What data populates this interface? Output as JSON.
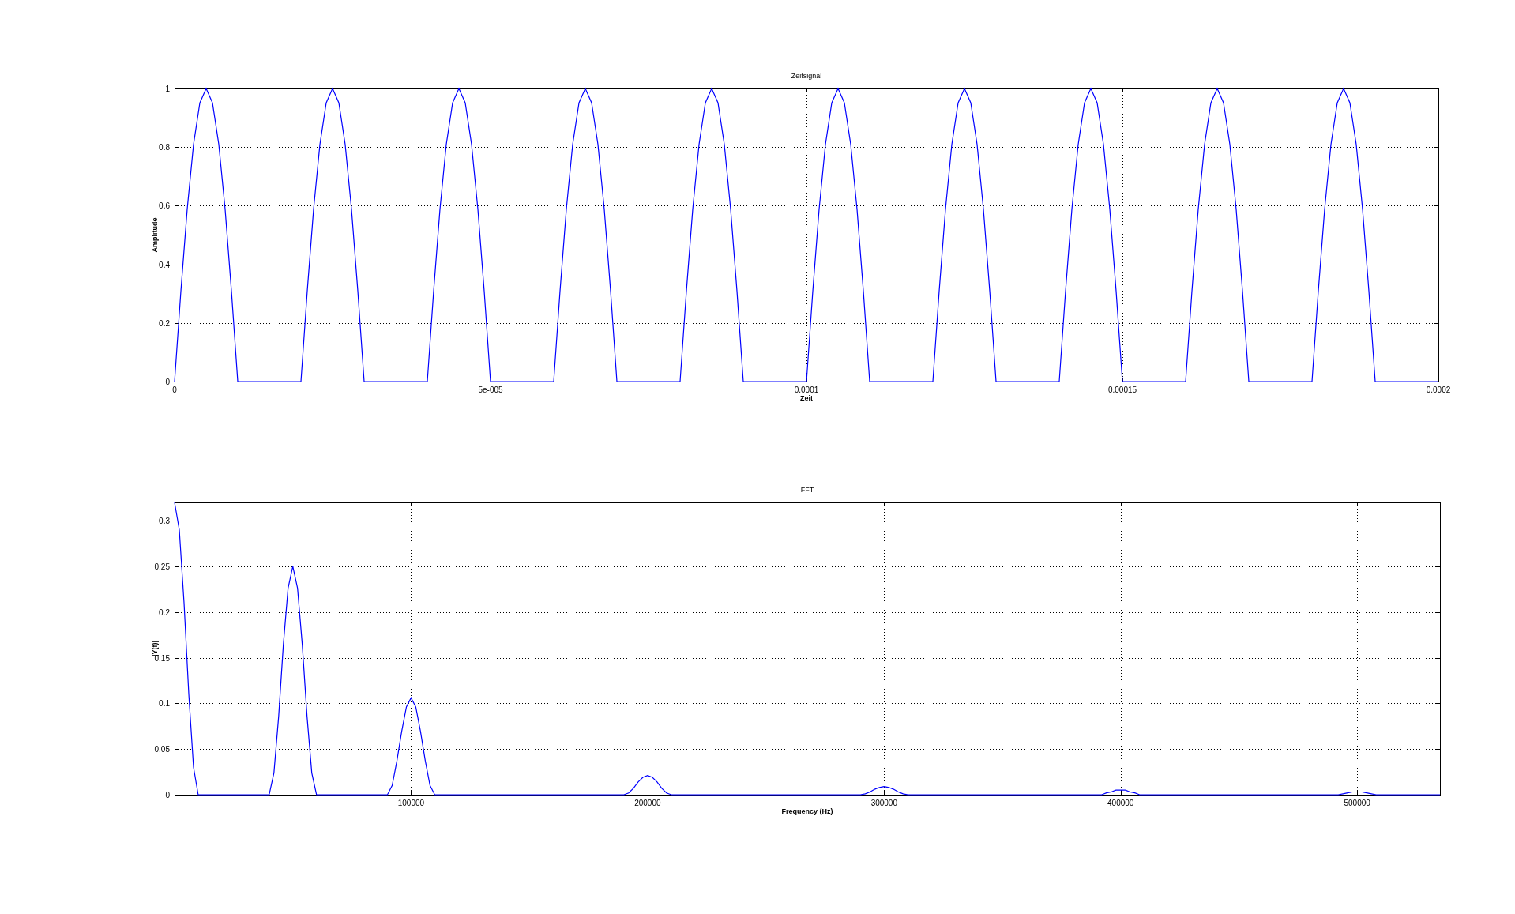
{
  "plots": [
    {
      "chart_data": {
        "type": "line",
        "title": "Zeitsignal",
        "xlabel": "Zeit",
        "ylabel": "Amplitude",
        "x": [
          0,
          1e-06,
          2e-06,
          3e-06,
          4e-06,
          5e-06,
          6e-06,
          7e-06,
          8e-06,
          9e-06,
          1e-05,
          2e-05,
          2.1e-05,
          2.2e-05,
          2.3e-05,
          2.4e-05,
          2.5e-05,
          2.6e-05,
          2.7e-05,
          2.8e-05,
          2.9e-05,
          3e-05,
          4e-05,
          4.1e-05,
          4.2e-05,
          4.3e-05,
          4.4e-05,
          4.5e-05,
          4.6e-05,
          4.7e-05,
          4.8e-05,
          4.9e-05,
          5e-05,
          6e-05,
          6.1e-05,
          6.2e-05,
          6.3e-05,
          6.4e-05,
          6.5e-05,
          6.6e-05,
          6.7e-05,
          6.8e-05,
          6.9e-05,
          7e-05,
          8e-05,
          8.1e-05,
          8.2e-05,
          8.3e-05,
          8.4e-05,
          8.5e-05,
          8.6e-05,
          8.7e-05,
          8.8e-05,
          8.9e-05,
          9e-05,
          0.0001,
          0.000101,
          0.000102,
          0.000103,
          0.000104,
          0.000105,
          0.000106,
          0.000107,
          0.000108,
          0.000109,
          0.00011,
          0.00012,
          0.000121,
          0.000122,
          0.000123,
          0.000124,
          0.000125,
          0.000126,
          0.000127,
          0.000128,
          0.000129,
          0.00013,
          0.00014,
          0.000141,
          0.000142,
          0.000143,
          0.000144,
          0.000145,
          0.000146,
          0.000147,
          0.000148,
          0.000149,
          0.00015,
          0.00016,
          0.000161,
          0.000162,
          0.000163,
          0.000164,
          0.000165,
          0.000166,
          0.000167,
          0.000168,
          0.000169,
          0.00017,
          0.00018,
          0.000181,
          0.000182,
          0.000183,
          0.000184,
          0.000185,
          0.000186,
          0.000187,
          0.000188,
          0.000189,
          0.00019,
          0.0002
        ],
        "series": [
          {
            "color": "#0000ff",
            "values": [
              0,
              0.309,
              0.588,
              0.809,
              0.951,
              1,
              0.951,
              0.809,
              0.588,
              0.309,
              0,
              0,
              0.309,
              0.588,
              0.809,
              0.951,
              1,
              0.951,
              0.809,
              0.588,
              0.309,
              0,
              0,
              0.309,
              0.588,
              0.809,
              0.951,
              1,
              0.951,
              0.809,
              0.588,
              0.309,
              0,
              0,
              0.309,
              0.588,
              0.809,
              0.951,
              1,
              0.951,
              0.809,
              0.588,
              0.309,
              0,
              0,
              0.309,
              0.588,
              0.809,
              0.951,
              1,
              0.951,
              0.809,
              0.588,
              0.309,
              0,
              0,
              0.309,
              0.588,
              0.809,
              0.951,
              1,
              0.951,
              0.809,
              0.588,
              0.309,
              0,
              0,
              0.309,
              0.588,
              0.809,
              0.951,
              1,
              0.951,
              0.809,
              0.588,
              0.309,
              0,
              0,
              0.309,
              0.588,
              0.809,
              0.951,
              1,
              0.951,
              0.809,
              0.588,
              0.309,
              0,
              0,
              0.309,
              0.588,
              0.809,
              0.951,
              1,
              0.951,
              0.809,
              0.588,
              0.309,
              0,
              0,
              0.309,
              0.588,
              0.809,
              0.951,
              1,
              0.951,
              0.809,
              0.588,
              0.309,
              0,
              0
            ]
          }
        ],
        "xlim": [
          0,
          0.0002
        ],
        "ylim": [
          0,
          1
        ],
        "xticks": [
          0,
          {
            "value": 5e-05,
            "label": "5e-005"
          },
          0.0001,
          0.00015,
          0.0002
        ],
        "yticks": [
          0,
          0.2,
          0.4,
          0.6,
          0.8,
          1
        ],
        "grid": true
      }
    },
    {
      "chart_data": {
        "type": "line",
        "title": "FFT",
        "xlabel": "Frequency (Hz)",
        "ylabel": "|Y(f)|",
        "x": [
          0,
          2000,
          4000,
          6000,
          8000,
          10000,
          40000,
          42000,
          44000,
          46000,
          48000,
          50000,
          52000,
          54000,
          56000,
          58000,
          60000,
          90000,
          92000,
          94000,
          96000,
          98000,
          100000,
          102000,
          104000,
          106000,
          108000,
          110000,
          190000,
          192000,
          194000,
          196000,
          198000,
          200000,
          202000,
          204000,
          206000,
          208000,
          210000,
          290000,
          292000,
          294000,
          296000,
          298000,
          300000,
          302000,
          304000,
          306000,
          308000,
          310000,
          390000,
          392000,
          394000,
          396000,
          398000,
          400000,
          402000,
          404000,
          406000,
          408000,
          410000,
          490000,
          492000,
          494000,
          496000,
          498000,
          500000,
          502000,
          504000,
          506000,
          508000,
          510000,
          535000
        ],
        "series": [
          {
            "color": "#0000ff",
            "values": [
              0.32,
              0.29,
              0.21,
              0.11,
              0.03,
              0,
              0,
              0.024,
              0.086,
              0.164,
              0.226,
              0.25,
              0.226,
              0.164,
              0.086,
              0.024,
              0,
              0,
              0.01,
              0.037,
              0.069,
              0.096,
              0.106,
              0.096,
              0.069,
              0.037,
              0.01,
              0,
              0,
              0.002,
              0.007,
              0.014,
              0.019,
              0.021,
              0.019,
              0.014,
              0.007,
              0.002,
              0,
              0,
              0.001,
              0.003,
              0.006,
              0.008,
              0.009,
              0.008,
              0.006,
              0.003,
              0.001,
              0,
              0,
              0,
              0.002,
              0.003,
              0.005,
              0.005,
              0.005,
              0.003,
              0.002,
              0,
              0,
              0,
              0,
              0.001,
              0.002,
              0.003,
              0.003,
              0.003,
              0.002,
              0.001,
              0,
              0,
              0
            ]
          }
        ],
        "xlim": [
          0,
          535000
        ],
        "ylim": [
          0,
          0.32
        ],
        "xticks": [
          100000,
          200000,
          300000,
          400000,
          500000
        ],
        "yticks": [
          0,
          0.05,
          0.1,
          0.15,
          0.2,
          0.25,
          0.3
        ],
        "grid": true
      }
    }
  ]
}
